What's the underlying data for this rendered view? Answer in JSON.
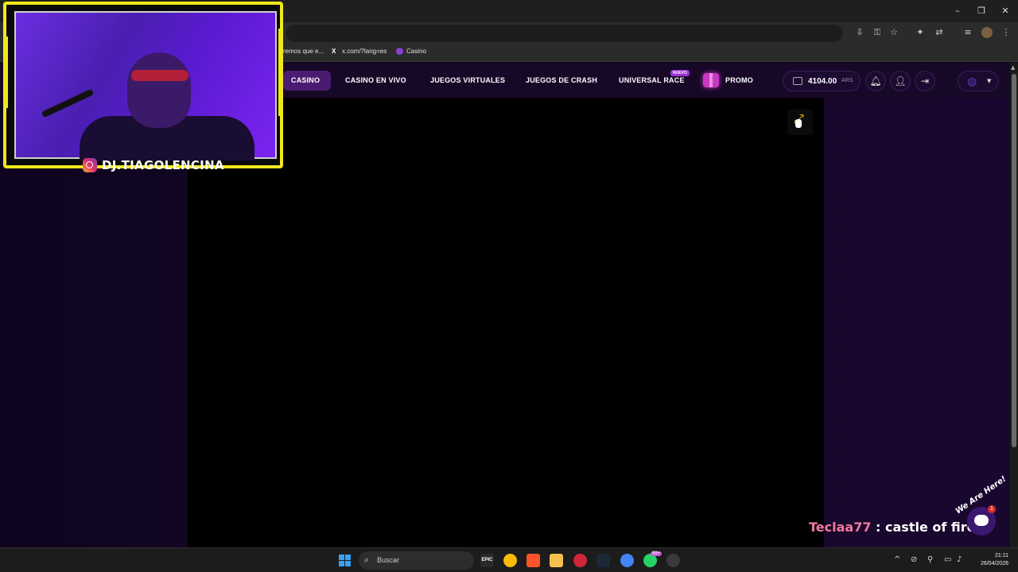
{
  "browser": {
    "window_controls": [
      "–",
      "❐",
      "✕"
    ],
    "bookmarks": [
      {
        "label": "remos que e..."
      },
      {
        "label": "x.com/?lang=es"
      },
      {
        "label": "Casino"
      }
    ]
  },
  "nav": {
    "items": [
      "CASINO",
      "CASINO EN VIVO",
      "JUEGOS VIRTUALES",
      "JUEGOS DE CRASH",
      "UNIVERSAL RACE"
    ],
    "badge_new": "NUEVO",
    "promo": "PROMO",
    "balance_amount": "4104.00",
    "balance_currency": "ARS"
  },
  "stream": {
    "instagram_handle": "DJ.TIAGOLENCINA",
    "chat_user": "Teclaa77",
    "chat_separator": " : ",
    "chat_message": "castle of fire",
    "we_are_here": "We Are Here!",
    "chat_notifications": "1"
  },
  "taskbar": {
    "search_placeholder": "Buscar",
    "badge_count": "99+",
    "time": "21:11",
    "date": "26/04/2026"
  },
  "colors": {
    "accent": "#4a1b70",
    "chat_user": "#f07aa0",
    "cam_frame": "#f0e81a"
  }
}
